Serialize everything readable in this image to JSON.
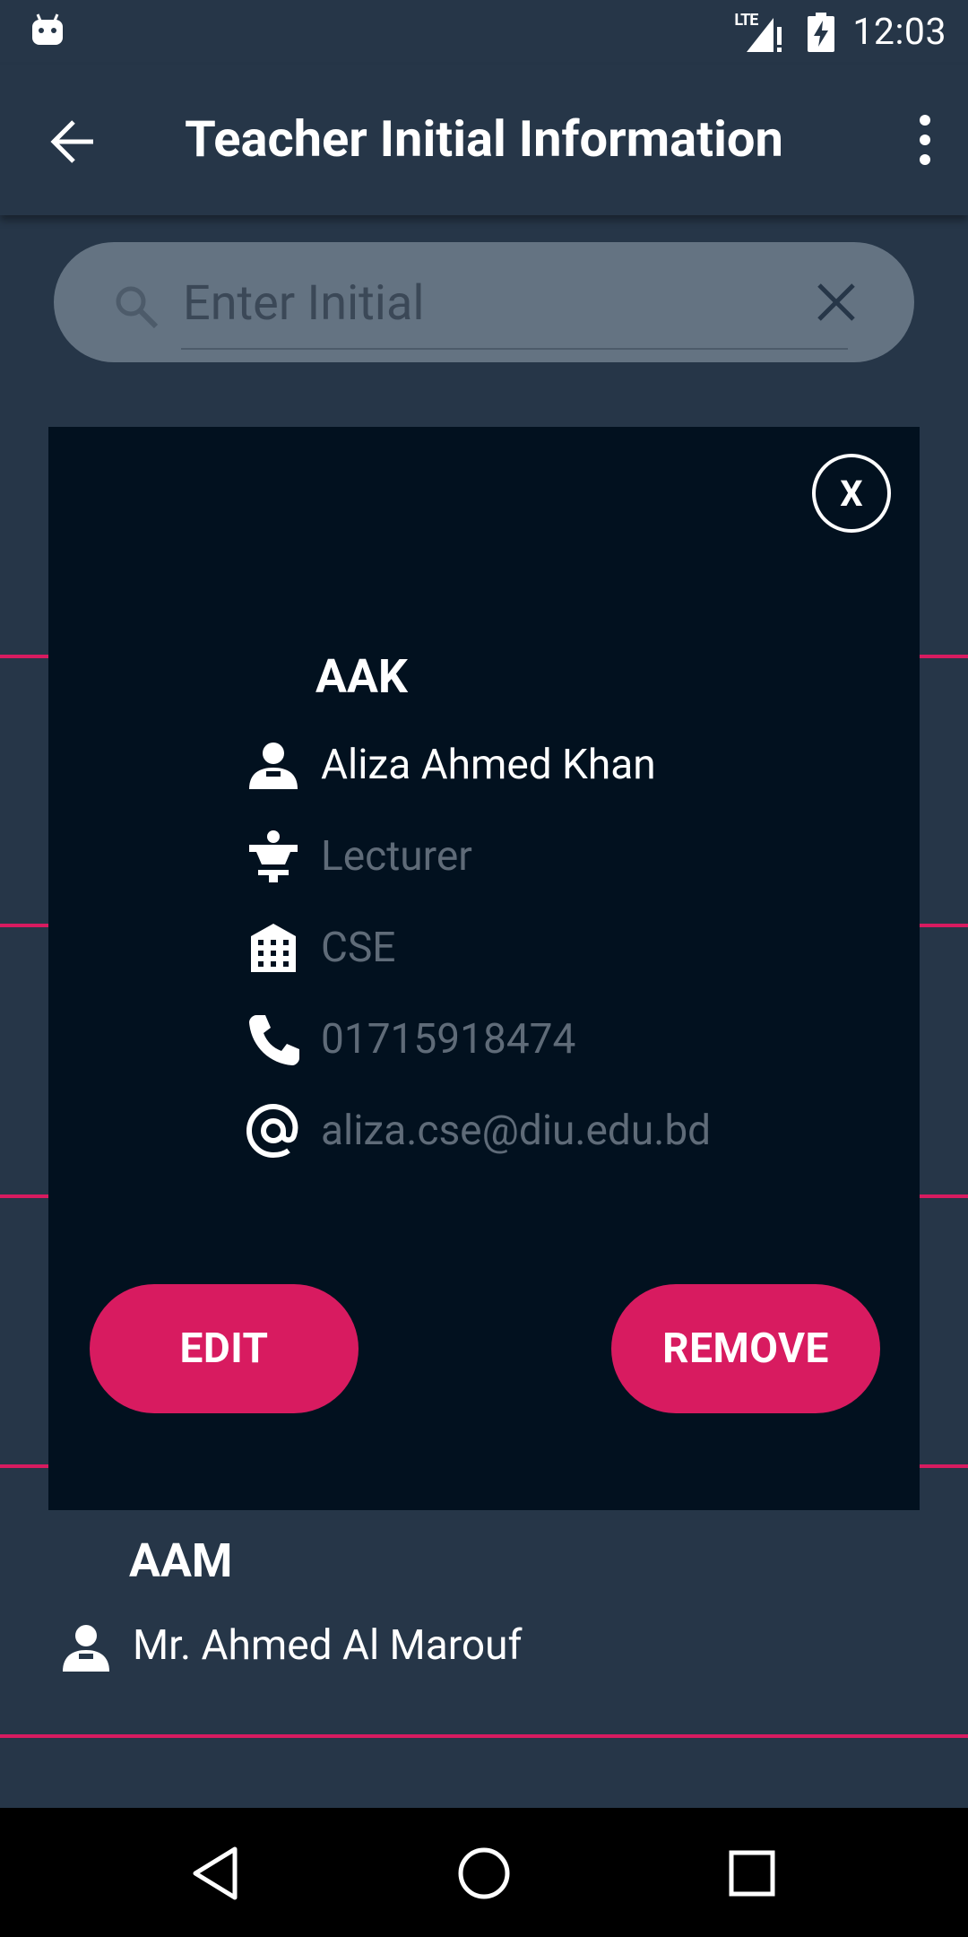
{
  "status_bar": {
    "time": "12:03",
    "network_label": "LTE",
    "icons": [
      "android-debug-icon",
      "signal-lte-icon",
      "battery-charging-icon"
    ]
  },
  "app_bar": {
    "title": "Teacher Initial Information",
    "icons": [
      "back-arrow-icon",
      "more-vert-icon"
    ]
  },
  "search": {
    "placeholder": "Enter Initial",
    "value": "",
    "icons": [
      "search-icon",
      "clear-icon"
    ]
  },
  "dialog": {
    "close_label": "X",
    "initial": "AAK",
    "name": "Aliza Ahmed Khan",
    "designation": "Lecturer",
    "department": "CSE",
    "phone": "01715918474",
    "email": "aliza.cse@diu.edu.bd",
    "edit_label": "EDIT",
    "remove_label": "REMOVE",
    "icons": [
      "person-icon",
      "lecturer-icon",
      "building-icon",
      "phone-icon",
      "at-sign-icon"
    ]
  },
  "list": {
    "visible_item": {
      "initial": "AAM",
      "name": "Mr. Ahmed Al Marouf"
    }
  },
  "colors": {
    "background": "#263648",
    "dialog": "#02111f",
    "accent": "#d81b60",
    "muted_text": "#5f6b78",
    "search_bg": "#647382"
  },
  "nav_bar": {
    "icons": [
      "nav-back-icon",
      "nav-home-icon",
      "nav-recents-icon"
    ]
  }
}
